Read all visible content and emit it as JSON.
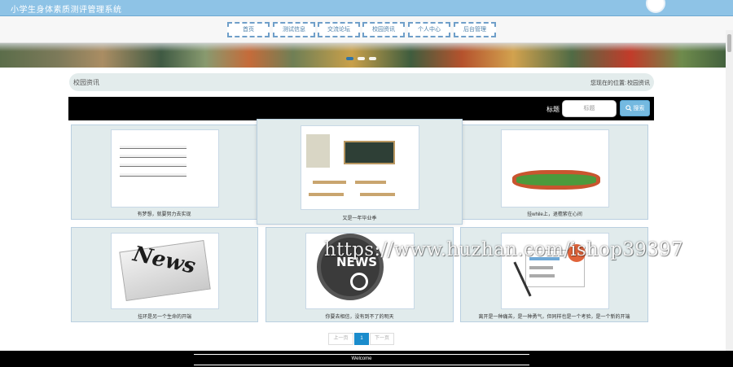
{
  "header": {
    "site_title": "小学生身体素质测评管理系统"
  },
  "nav": {
    "items": [
      {
        "label": "首页"
      },
      {
        "label": "测试信息"
      },
      {
        "label": "交流论坛"
      },
      {
        "label": "校园资讯"
      },
      {
        "label": "个人中心"
      },
      {
        "label": "后台管理"
      }
    ]
  },
  "section": {
    "title": "校园资讯",
    "breadcrumb_prefix": "您现在的位置:",
    "breadcrumb_current": "校园资讯"
  },
  "search": {
    "label": "标题",
    "placeholder": "标题",
    "button_label": "搜索",
    "button_icon": "search-icon"
  },
  "news": [
    {
      "caption": "有梦想，就要努力去实现",
      "image": "school-building"
    },
    {
      "caption": "又是一年毕业季",
      "image": "classroom"
    },
    {
      "caption": "挂while上，退檐紫在心间",
      "image": "sports-field"
    },
    {
      "caption": "挂环是另一个生命的开端",
      "image": "newspaper"
    },
    {
      "caption": "你要去相信，没有到不了的明天",
      "image": "news-globe"
    },
    {
      "caption": "离开是一种痛苦，是一种勇气，但同样也是一个考验，是一个新的开端",
      "image": "newspaper-desk"
    }
  ],
  "pagination": {
    "prev": "上一页",
    "current": "1",
    "next": "下一页"
  },
  "watermark": "https://www.huzhan.com/ishop39397",
  "footer": {
    "text": "Welcome"
  },
  "colors": {
    "header": "#8ec3e6",
    "accent": "#1b8ccc",
    "card": "#e1ebec"
  }
}
